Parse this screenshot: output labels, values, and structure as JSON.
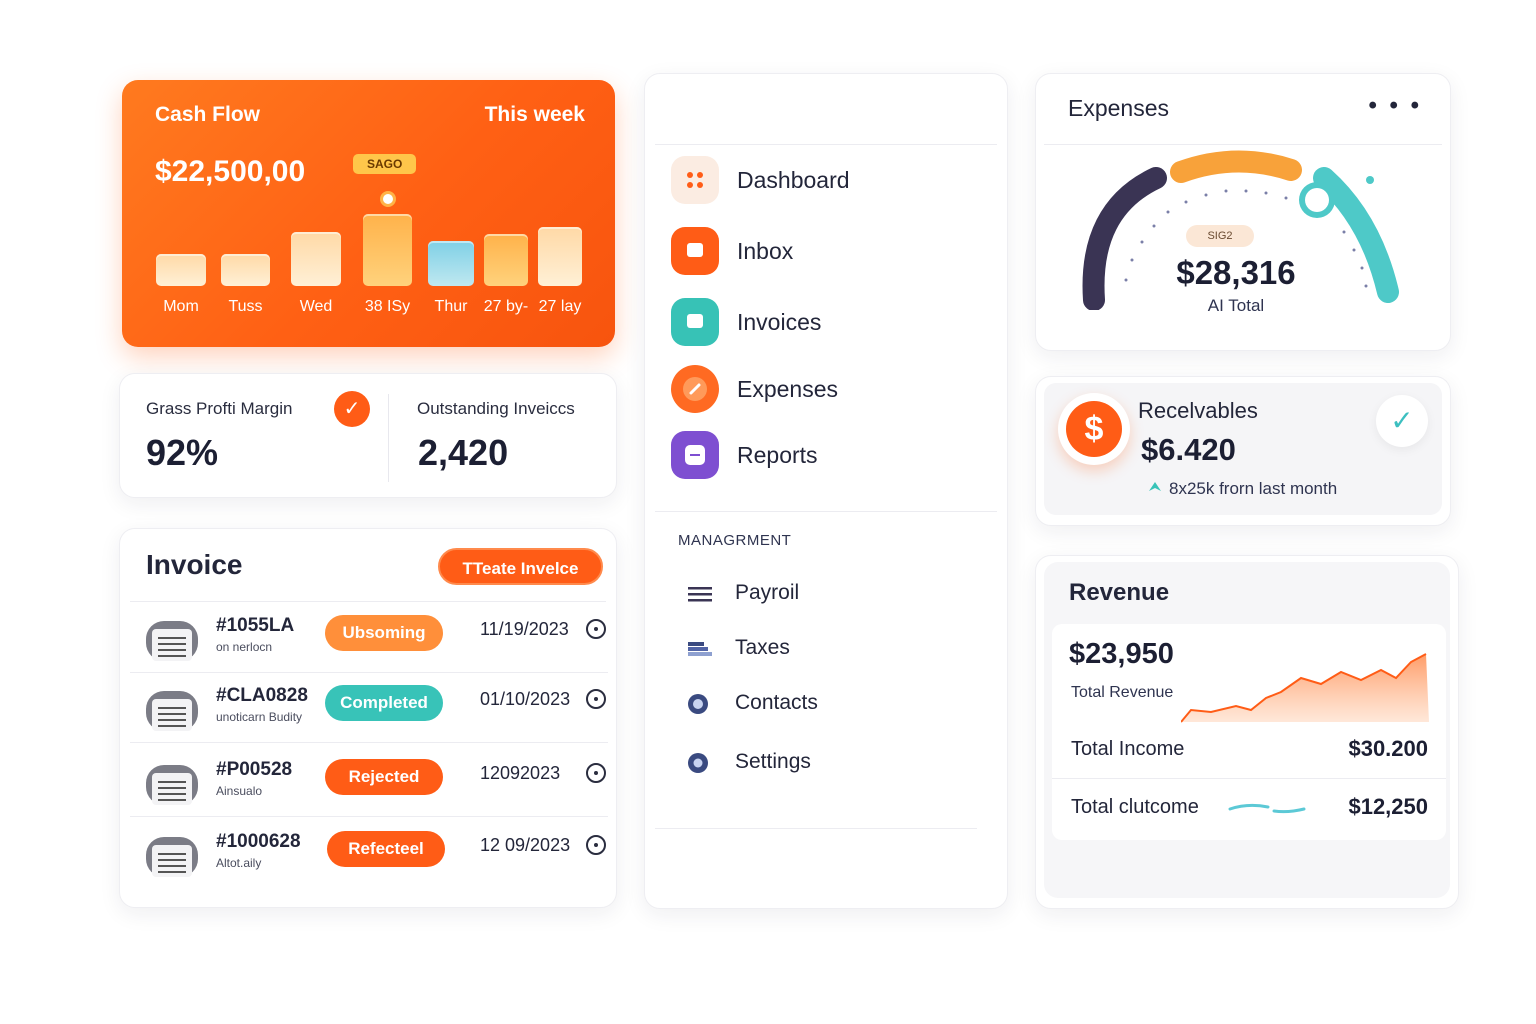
{
  "cash_flow": {
    "title": "Cash Flow",
    "period": "This week",
    "amount": "$22,500,00",
    "tag": "SAGO",
    "chart_data": {
      "type": "bar",
      "categories": [
        "Mom",
        "Tuss",
        "Wed",
        "38 ISy",
        "Thur",
        "27 by-",
        "27 lay"
      ],
      "values": [
        34,
        34,
        57,
        76,
        47,
        55,
        62
      ]
    }
  },
  "metrics": {
    "margin_label": "Grass Profti Margin",
    "margin_value": "92%",
    "outstanding_label": "Outstanding Inveiccs",
    "outstanding_value": "2,420"
  },
  "invoice": {
    "title": "Invoice",
    "create_label": "TTeate Invelce",
    "rows": [
      {
        "id": "#1055LA",
        "sub": "on nerlocn",
        "status": "Ubsoming",
        "date": "11/19/2023",
        "color": "#ff8f3a"
      },
      {
        "id": "#CLA0828",
        "sub": "unoticarn Budity",
        "status": "Completed",
        "date": "01/10/2023",
        "color": "#38c3b8"
      },
      {
        "id": "#P00528",
        "sub": "Ainsualo",
        "status": "Rejected",
        "date": "12092023",
        "color": "#ff5c16"
      },
      {
        "id": "#1000628",
        "sub": "Altot.aily",
        "status": "Refecteel",
        "date": "12 09/2023",
        "color": "#ff5c16"
      }
    ]
  },
  "nav": {
    "items": [
      {
        "label": "Dashboard",
        "icon": "grid-icon",
        "color": "#fbece2"
      },
      {
        "label": "Inbox",
        "icon": "inbox-icon",
        "color": "#ff5c16"
      },
      {
        "label": "Invoices",
        "icon": "invoice-icon",
        "color": "#37c2b6"
      },
      {
        "label": "Expenses",
        "icon": "expense-icon",
        "color": "#ff6a22"
      },
      {
        "label": "Reports",
        "icon": "report-icon",
        "color": "#7e4fd1"
      }
    ],
    "section": "MANAGRMENT",
    "sub_items": [
      {
        "label": "Payroil",
        "icon": "menu-lines-icon"
      },
      {
        "label": "Taxes",
        "icon": "stack-icon"
      },
      {
        "label": "Contacts",
        "icon": "contacts-icon"
      },
      {
        "label": "Settings",
        "icon": "settings-icon"
      }
    ]
  },
  "expenses": {
    "title": "Expenses",
    "more": "• • •",
    "badge": "SIG2",
    "value": "$28,316",
    "caption": "AI Total"
  },
  "receivables": {
    "title": "Recelvables",
    "value": "$6.420",
    "trend": "8x25k frorn last month",
    "dollar": "$",
    "check": "✓"
  },
  "revenue": {
    "title": "Revenue",
    "amount": "$23,950",
    "amount_label": "Total Revenue",
    "income_label": "Total Income",
    "income_value": "$30.200",
    "outcome_label": "Total clutcome",
    "outcome_value": "$12,250"
  },
  "colors": {
    "accent": "#ff5c16",
    "teal": "#38c3b8",
    "purple": "#7e4fd1",
    "navy": "#3a3454"
  }
}
